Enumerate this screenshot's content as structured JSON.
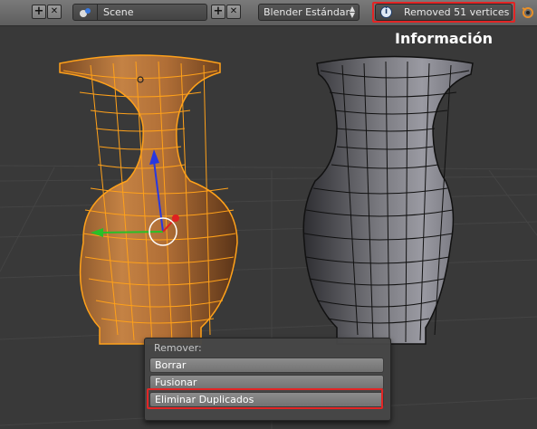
{
  "header": {
    "scene_label": "Scene",
    "render_engine": "Blender Estándar",
    "info_message": "Removed 51 vertices",
    "add_symbol": "+",
    "close_symbol": "✕",
    "info_symbol": "i"
  },
  "viewport": {
    "overlay_title": "Información"
  },
  "context_menu": {
    "title": "Remover:",
    "items": [
      {
        "label": "Borrar"
      },
      {
        "label": "Fusionar"
      },
      {
        "label": "Eliminar Duplicados"
      }
    ]
  },
  "colors": {
    "highlight_border": "#e22525",
    "selected_wire": "#ffa11a",
    "mesh_fill_selected": "#b8743a",
    "wire_unselected": "#111111",
    "mesh_fill_unselected": "#6e6e72",
    "gizmo_x": "#e02020",
    "gizmo_y": "#28c028",
    "gizmo_z": "#2838e0"
  },
  "icons": [
    "add-icon",
    "close-icon",
    "scene-icon",
    "spinner-icon",
    "info-icon",
    "render-icon"
  ]
}
